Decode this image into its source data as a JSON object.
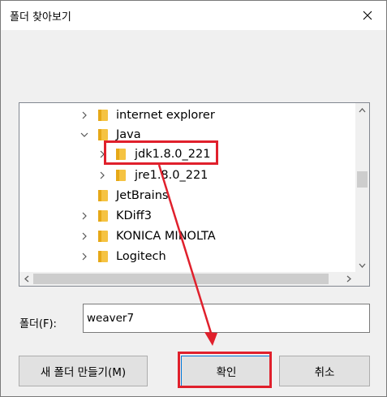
{
  "window": {
    "title": "폴더 찾아보기"
  },
  "tree": {
    "items": [
      {
        "label": "internet explorer",
        "expander": "collapsed"
      },
      {
        "label": "Java",
        "expander": "expanded"
      },
      {
        "label": "jdk1.8.0_221",
        "expander": "collapsed"
      },
      {
        "label": "jre1.8.0_221",
        "expander": "collapsed"
      },
      {
        "label": "JetBrains",
        "expander": "none"
      },
      {
        "label": "KDiff3",
        "expander": "collapsed"
      },
      {
        "label": "KONICA MINOLTA",
        "expander": "collapsed"
      },
      {
        "label": "Logitech",
        "expander": "collapsed"
      }
    ]
  },
  "folder_field": {
    "label": "폴더(F):",
    "value": "weaver7"
  },
  "buttons": {
    "new_folder": "새 폴더 만들기(M)",
    "ok": "확인",
    "cancel": "취소"
  },
  "colors": {
    "annotation_red": "#e0202c",
    "folder_yellow": "#f5c342",
    "focus_blue": "#0078d7"
  }
}
